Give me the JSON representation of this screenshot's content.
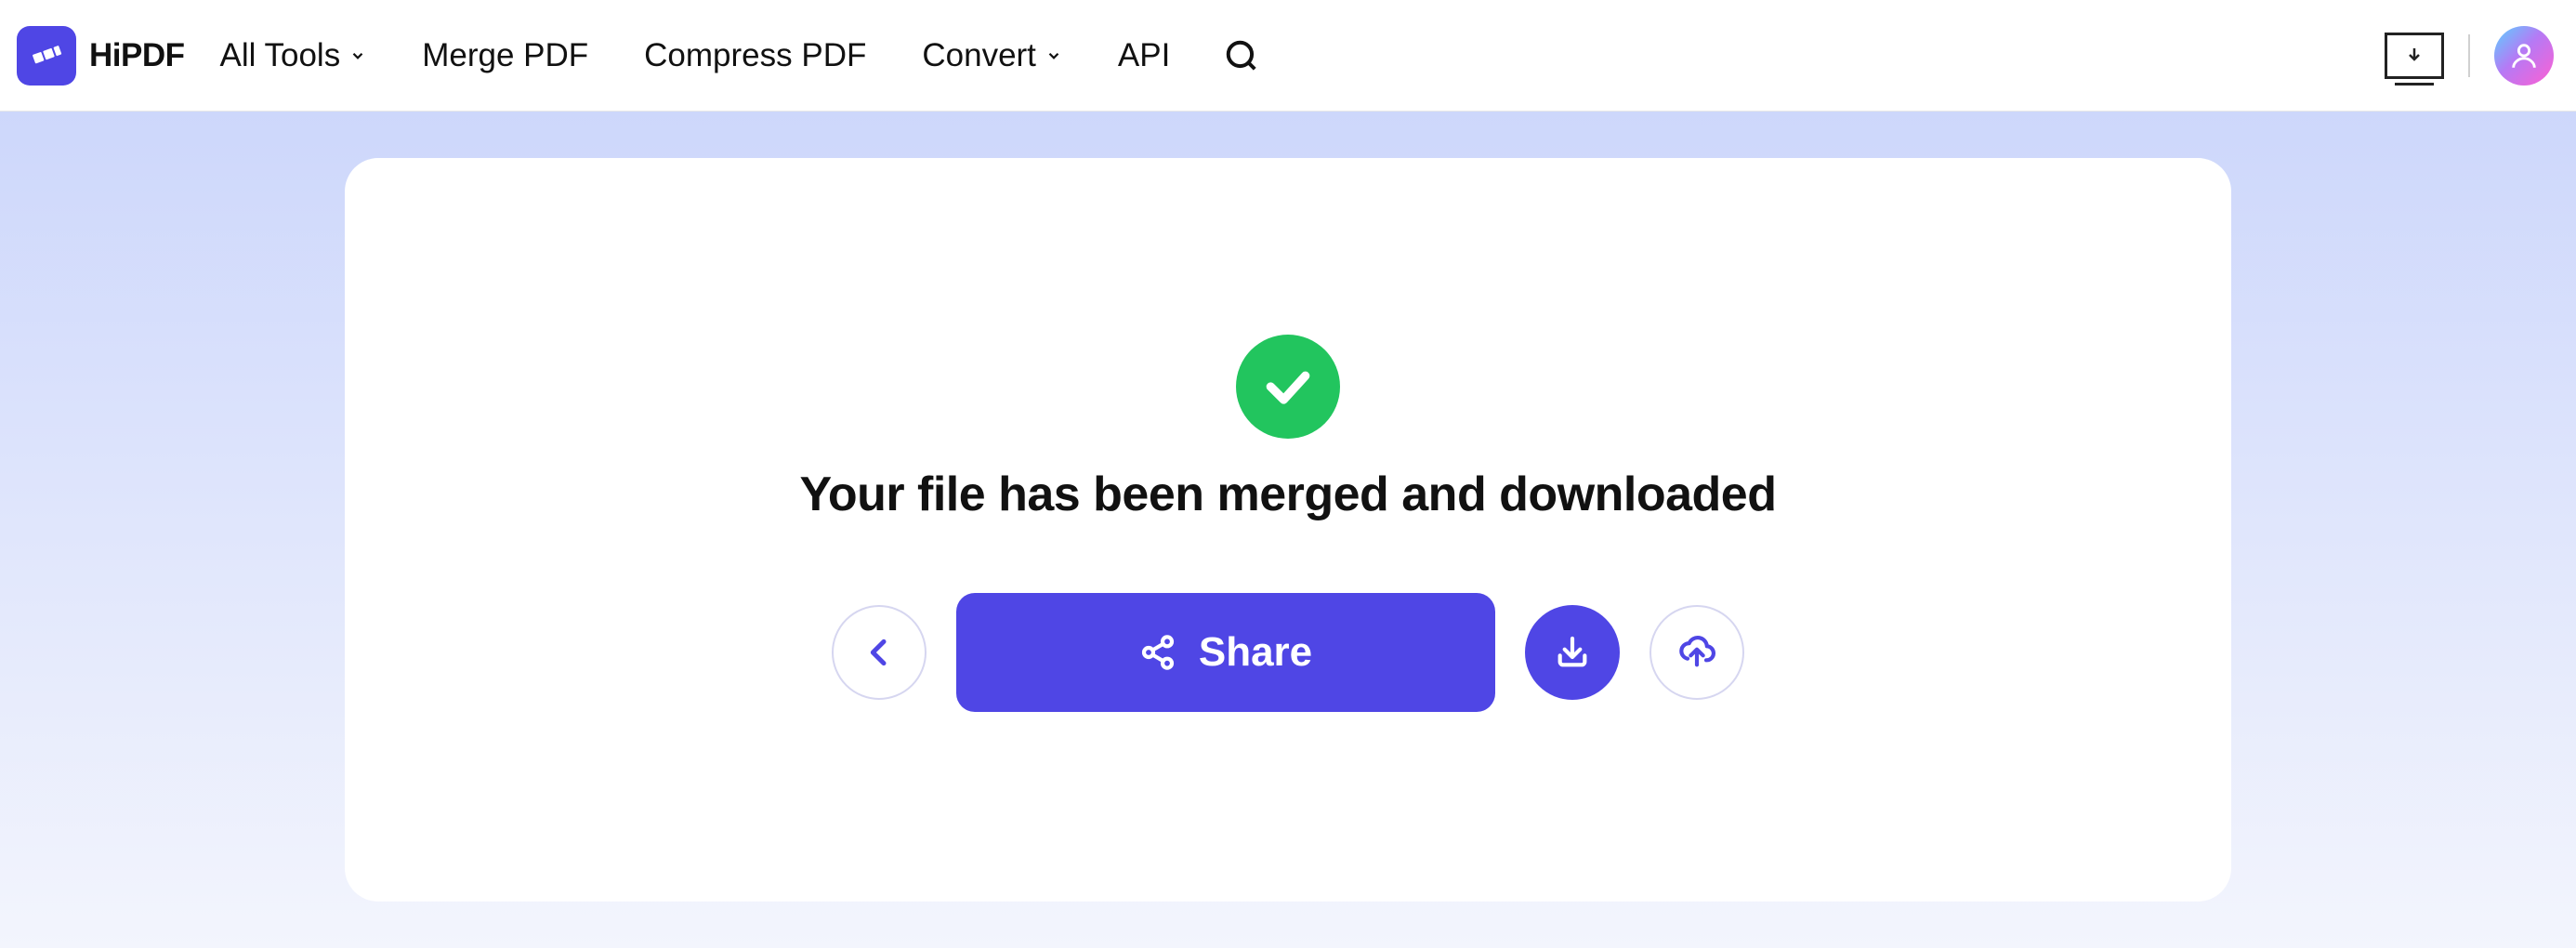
{
  "brand": "HiPDF",
  "nav": {
    "all_tools": "All Tools",
    "merge": "Merge PDF",
    "compress": "Compress PDF",
    "convert": "Convert",
    "api": "API"
  },
  "success": {
    "title": "Your file has been merged and downloaded",
    "share_label": "Share"
  },
  "colors": {
    "primary": "#4f46e5",
    "success": "#22c55e"
  }
}
